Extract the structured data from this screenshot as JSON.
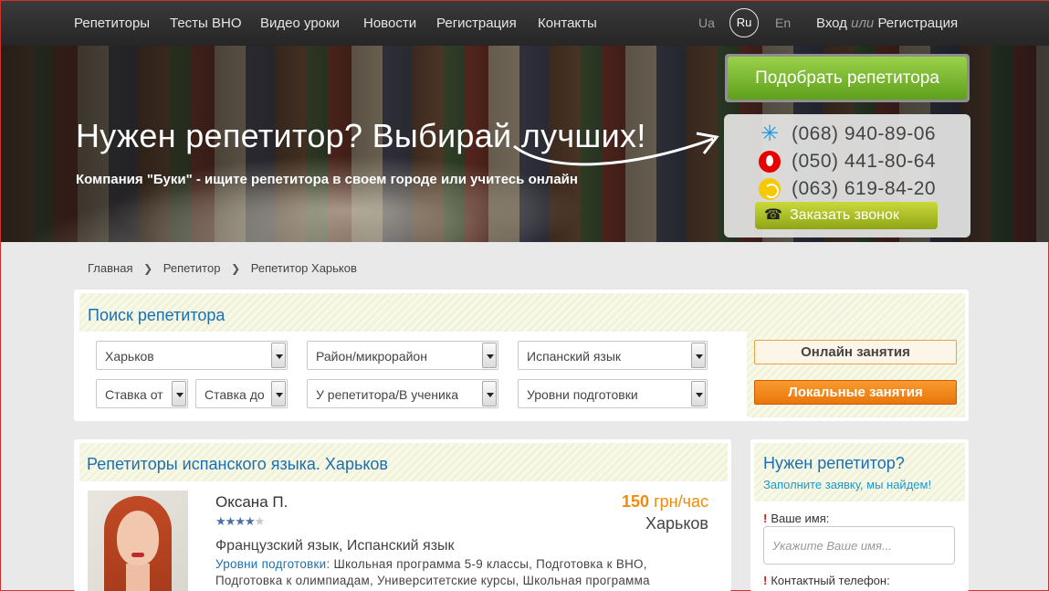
{
  "nav": {
    "items": [
      "Репетиторы",
      "Тесты ВНО",
      "Видео уроки",
      "Новости",
      "Регистрация",
      "Контакты"
    ],
    "languages": [
      "Ua",
      "Ru",
      "En"
    ],
    "active_language": "Ru",
    "login": "Вход",
    "or": "или",
    "register": "Регистрация"
  },
  "hero": {
    "title": "Нужен репетитор? Выбирай лучших!",
    "subtitle": "Компания \"Буки\" - ищите репетитора в своем городе или учитесь онлайн",
    "pick_button": "Подобрать репетитора",
    "phones": [
      {
        "operator_icon": "kyivstar-icon",
        "number": "(068) 940-89-06"
      },
      {
        "operator_icon": "vodafone-icon",
        "number": "(050) 441-80-64"
      },
      {
        "operator_icon": "lifecell-icon",
        "number": "(063) 619-84-20"
      }
    ],
    "callback_button": "Заказать звонок"
  },
  "breadcrumb": [
    "Главная",
    "Репетитор",
    "Репетитор Харьков"
  ],
  "search": {
    "title": "Поиск репетитора",
    "city": "Харьков",
    "district": "Район/микрорайон",
    "subject": "Испанский язык",
    "rate_from": "Ставка от",
    "rate_to": "Ставка до",
    "place": "У репетитора/В ученика",
    "levels": "Уровни подготовки",
    "online_button": "Онлайн занятия",
    "local_button": "Локальные занятия"
  },
  "results": {
    "title": "Репетиторы испанского языка. Харьков",
    "tutor": {
      "name": "Оксана П.",
      "rating": 4,
      "rating_max": 5,
      "price": "150",
      "price_unit": "грн/час",
      "city": "Харьков",
      "subjects": "Французский язык, Испанский язык",
      "levels_label": "Уровни подготовки:",
      "levels": "Школьная программа 5-9 классы, Подготовка к ВНО, Подготовка к олимпиадам, Университетские курсы, Школьная программа"
    }
  },
  "sidebar": {
    "title": "Нужен репетитор?",
    "subtitle": "Заполните заявку, мы найдем!",
    "name_label": "Ваше имя:",
    "name_placeholder": "Укажите Ваше имя...",
    "phone_label": "Контактный телефон:",
    "required_mark": "!"
  },
  "colors": {
    "accent_blue": "#1b6fb0",
    "price_orange": "#f08a10",
    "green_button": "#6fb328",
    "orange_button": "#ee7d10"
  }
}
